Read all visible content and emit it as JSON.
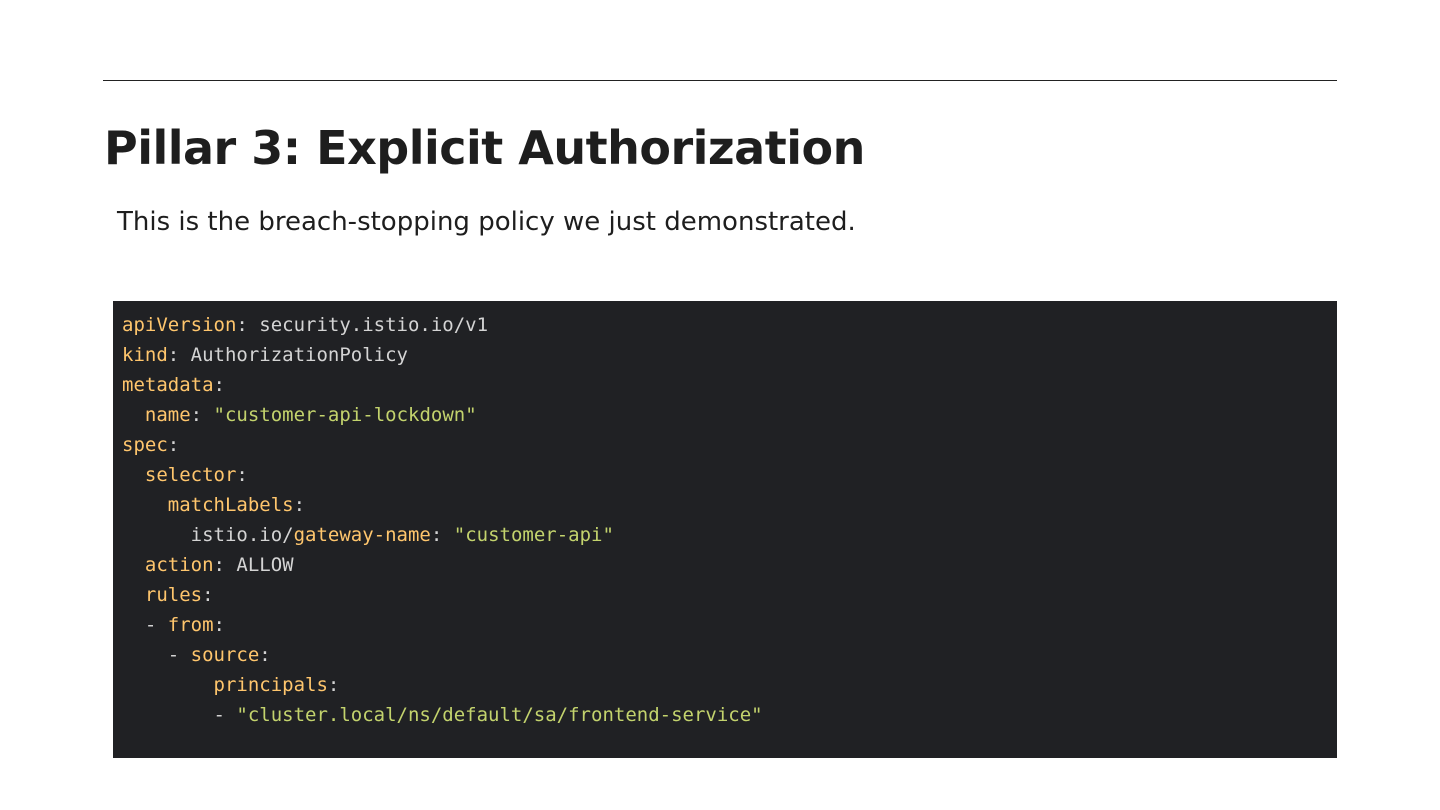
{
  "slide": {
    "title": "Pillar 3: Explicit Authorization",
    "subtitle": "This is the breach-stopping policy we just demonstrated."
  },
  "colors": {
    "background": "#ffffff",
    "text": "#1e1e1e",
    "code_background": "#202124",
    "code_key": "#ffc66d",
    "code_text": "#d4d4d4",
    "code_string": "#c3d36d"
  },
  "code": {
    "language": "yaml",
    "lines": [
      [
        {
          "t": "apiVersion",
          "k": "key"
        },
        {
          "t": ": security.istio.io/v1",
          "k": "text"
        }
      ],
      [
        {
          "t": "kind",
          "k": "key"
        },
        {
          "t": ": AuthorizationPolicy",
          "k": "text"
        }
      ],
      [
        {
          "t": "metadata",
          "k": "key"
        },
        {
          "t": ":",
          "k": "text"
        }
      ],
      [
        {
          "t": "  ",
          "k": "text"
        },
        {
          "t": "name",
          "k": "key"
        },
        {
          "t": ": ",
          "k": "text"
        },
        {
          "t": "\"customer-api-lockdown\"",
          "k": "string"
        }
      ],
      [
        {
          "t": "spec",
          "k": "key"
        },
        {
          "t": ":",
          "k": "text"
        }
      ],
      [
        {
          "t": "  ",
          "k": "text"
        },
        {
          "t": "selector",
          "k": "key"
        },
        {
          "t": ":",
          "k": "text"
        }
      ],
      [
        {
          "t": "    ",
          "k": "text"
        },
        {
          "t": "matchLabels",
          "k": "key"
        },
        {
          "t": ":",
          "k": "text"
        }
      ],
      [
        {
          "t": "      istio.io/",
          "k": "text"
        },
        {
          "t": "gateway-name",
          "k": "key"
        },
        {
          "t": ": ",
          "k": "text"
        },
        {
          "t": "\"customer-api\"",
          "k": "string"
        }
      ],
      [
        {
          "t": "  ",
          "k": "text"
        },
        {
          "t": "action",
          "k": "key"
        },
        {
          "t": ": ALLOW",
          "k": "text"
        }
      ],
      [
        {
          "t": "  ",
          "k": "text"
        },
        {
          "t": "rules",
          "k": "key"
        },
        {
          "t": ":",
          "k": "text"
        }
      ],
      [
        {
          "t": "  - ",
          "k": "text"
        },
        {
          "t": "from",
          "k": "key"
        },
        {
          "t": ":",
          "k": "text"
        }
      ],
      [
        {
          "t": "    - ",
          "k": "text"
        },
        {
          "t": "source",
          "k": "key"
        },
        {
          "t": ":",
          "k": "text"
        }
      ],
      [
        {
          "t": "        ",
          "k": "text"
        },
        {
          "t": "principals",
          "k": "key"
        },
        {
          "t": ":",
          "k": "text"
        }
      ],
      [
        {
          "t": "        - ",
          "k": "text"
        },
        {
          "t": "\"cluster.local/ns/default/sa/frontend-service\"",
          "k": "string"
        }
      ]
    ]
  }
}
